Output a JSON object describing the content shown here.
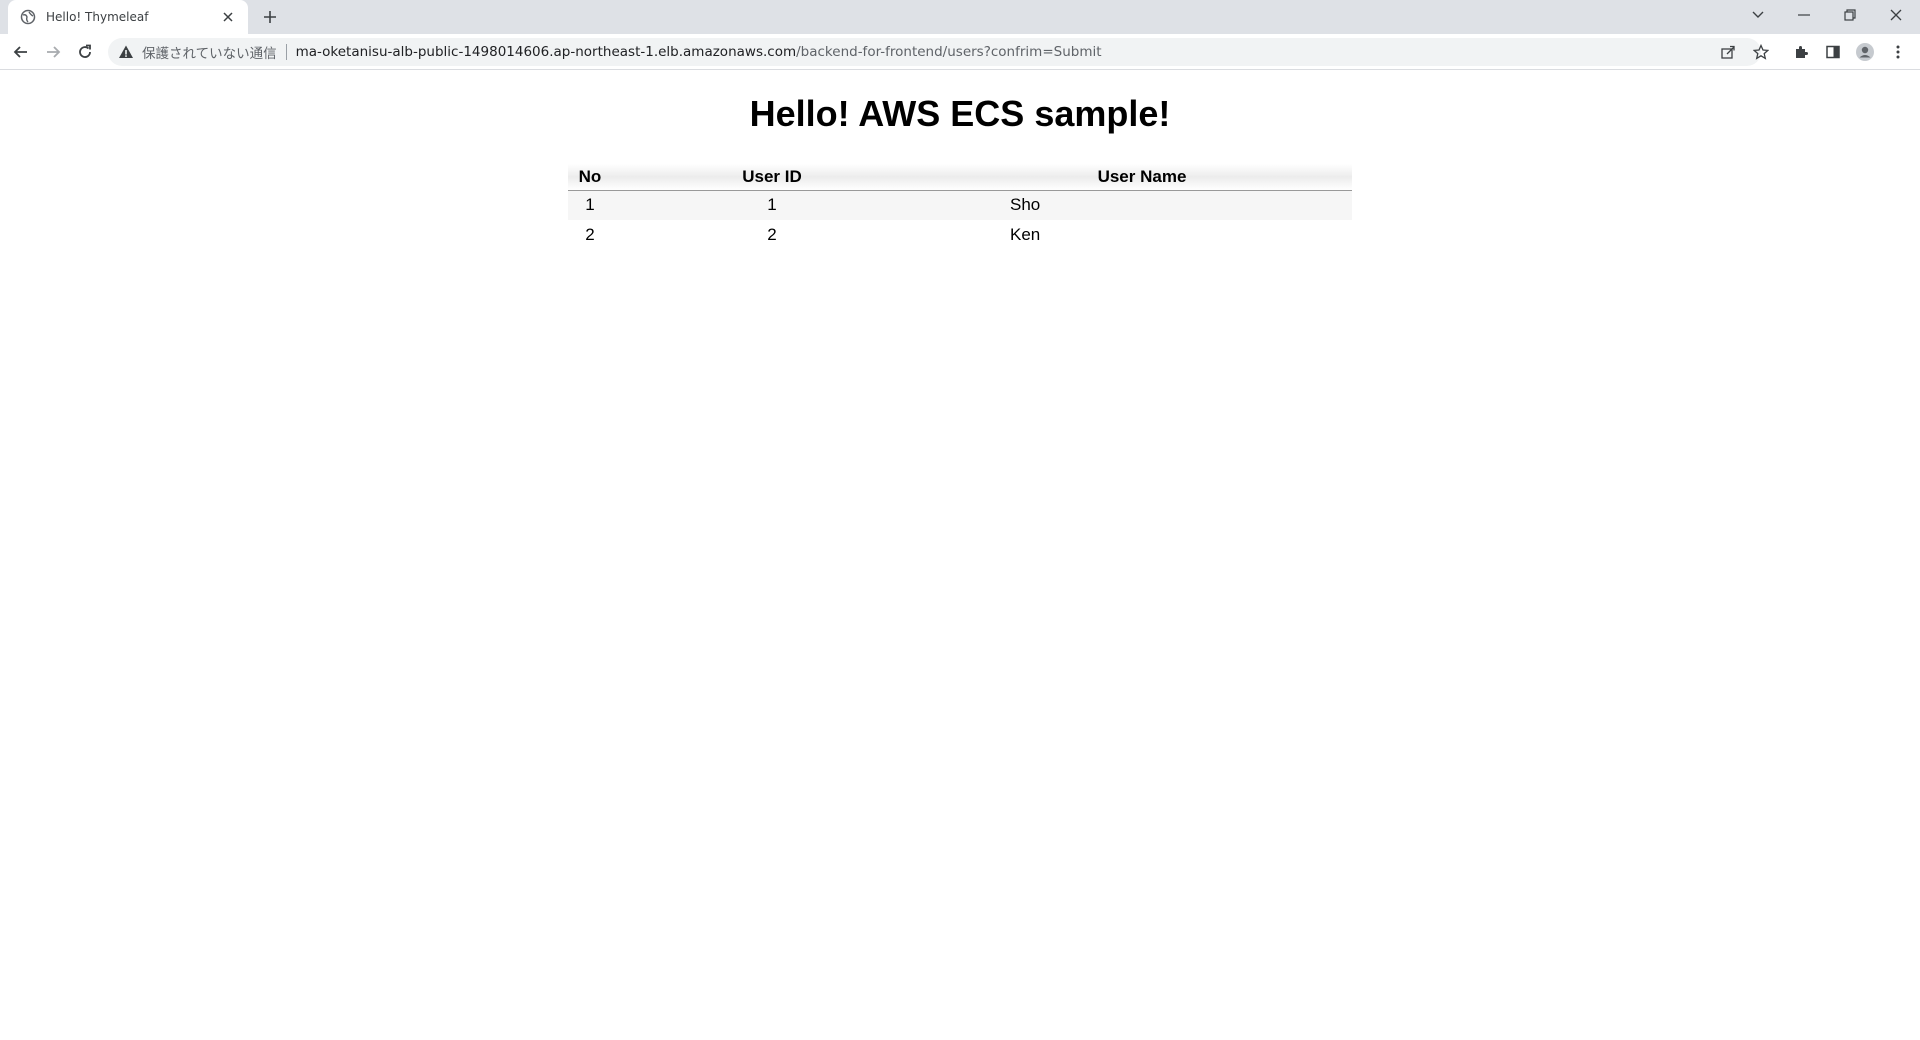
{
  "browser": {
    "tab_title": "Hello! Thymeleaf",
    "security_label": "保護されていない通信",
    "url_host": "ma-oketanisu-alb-public-1498014606.ap-northeast-1.elb.amazonaws.com",
    "url_path": "/backend-for-frontend/users?confrim=Submit"
  },
  "page": {
    "heading": "Hello! AWS ECS sample!"
  },
  "table": {
    "headers": [
      "No",
      "User ID",
      "User Name"
    ],
    "rows": [
      {
        "no": "1",
        "user_id": "1",
        "user_name": "Sho"
      },
      {
        "no": "2",
        "user_id": "2",
        "user_name": "Ken"
      }
    ]
  }
}
